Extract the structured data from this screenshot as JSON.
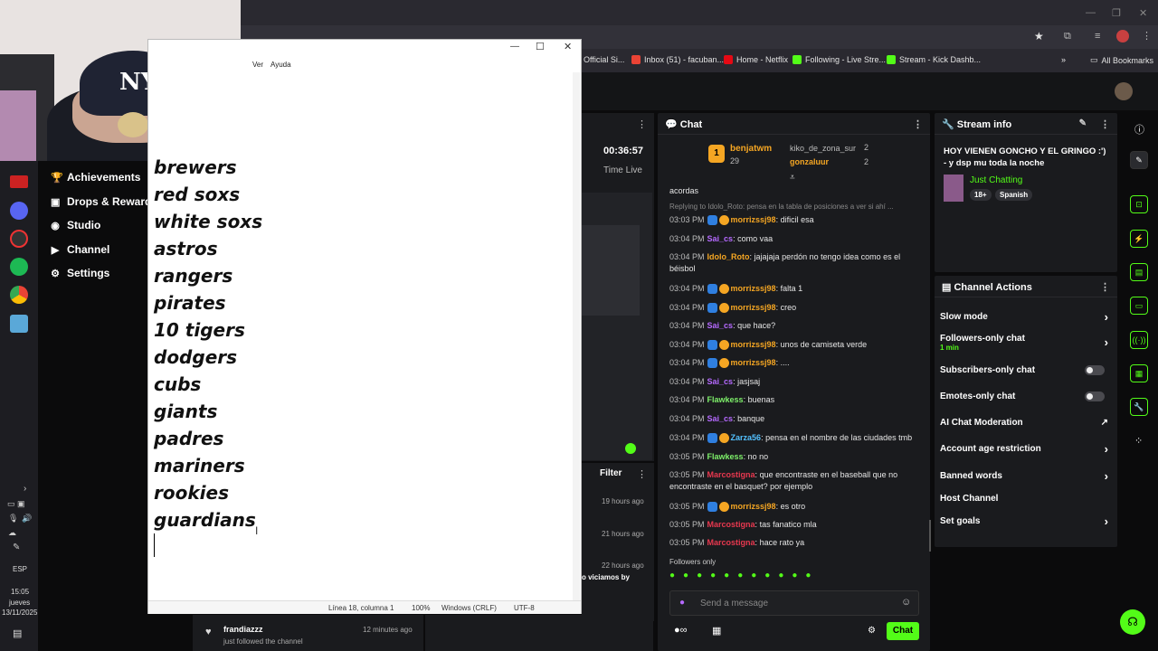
{
  "browser": {
    "bookmarks": [
      "Official Si...",
      "Inbox (51) - facuban...",
      "Home - Netflix",
      "Following - Live Stre...",
      "Stream - Kick Dashb..."
    ],
    "all_bookmarks": "All Bookmarks"
  },
  "left_nav": {
    "items": [
      {
        "label": "Achievements",
        "icon": "trophy-icon"
      },
      {
        "label": "Drops & Rewards",
        "icon": "gift-icon"
      },
      {
        "label": "Studio",
        "icon": "studio-icon"
      },
      {
        "label": "Channel",
        "icon": "channel-icon"
      },
      {
        "label": "Settings",
        "icon": "gear-icon"
      }
    ]
  },
  "taskbar": {
    "lang": "ESP",
    "time": "15:05",
    "day": "jueves",
    "date": "13/11/2025"
  },
  "notepad": {
    "menu_ver": "Ver",
    "menu_ayuda": "Ayuda",
    "lines": [
      "brewers",
      "red soxs",
      "white soxs",
      "astros",
      "rangers",
      "pirates",
      "10 tigers",
      "dodgers",
      "cubs",
      "giants",
      "padres",
      "mariners",
      "rookies",
      "guardians"
    ],
    "status": {
      "position": "Línea 18, columna 1",
      "zoom": "100%",
      "eol": "Windows (CRLF)",
      "encoding": "UTF-8"
    }
  },
  "mid": {
    "timer": "00:36:57",
    "timer_label": "Time Live",
    "filter": "Filter",
    "times": [
      "19 hours ago",
      "21 hours ago",
      "22 hours ago"
    ],
    "snippet": "o viciamos by"
  },
  "activity": {
    "user": "frandiazzz",
    "time": "12 minutes ago",
    "text": "just followed the channel"
  },
  "chat": {
    "title": "Chat",
    "top": {
      "user1": "benjatwm",
      "count1": "29",
      "user2": "kiko_de_zona_sur",
      "count2": "2",
      "user3": "gonzaluur",
      "count3": "2"
    },
    "pinned_text": "acordas",
    "reply_text": "Replying to Idolo_Roto: pensa en la tabla de posiciones a ver si ahí ...",
    "messages": [
      {
        "time": "03:03 PM",
        "user": "morrizssj98",
        "text": "dificil esa",
        "color": "#f5a623",
        "badges": true
      },
      {
        "time": "03:04 PM",
        "user": "Sai_cs",
        "text": "como vaa",
        "color": "#b569ff",
        "badges": false
      },
      {
        "time": "03:04 PM",
        "user": "Idolo_Roto",
        "text": "jajajaja perdón no tengo idea como es el béisbol",
        "color": "#f5a623",
        "badges": false
      },
      {
        "time": "03:04 PM",
        "user": "morrizssj98",
        "text": "falta 1",
        "color": "#f5a623",
        "badges": true
      },
      {
        "time": "03:04 PM",
        "user": "morrizssj98",
        "text": "creo",
        "color": "#f5a623",
        "badges": true
      },
      {
        "time": "03:04 PM",
        "user": "Sai_cs",
        "text": "que hace?",
        "color": "#b569ff",
        "badges": false
      },
      {
        "time": "03:04 PM",
        "user": "morrizssj98",
        "text": "unos de camiseta verde",
        "color": "#f5a623",
        "badges": true
      },
      {
        "time": "03:04 PM",
        "user": "morrizssj98",
        "text": "....",
        "color": "#f5a623",
        "badges": true
      },
      {
        "time": "03:04 PM",
        "user": "Sai_cs",
        "text": "jasjsaj",
        "color": "#b569ff",
        "badges": false
      },
      {
        "time": "03:04 PM",
        "user": "Flawkess",
        "text": "buenas",
        "color": "#7ef06a",
        "badges": false
      },
      {
        "time": "03:04 PM",
        "user": "Sai_cs",
        "text": "banque",
        "color": "#b569ff",
        "badges": false
      },
      {
        "time": "03:04 PM",
        "user": "Zarza56",
        "text": "pensa en el nombre de las ciudades tmb",
        "color": "#53c1ff",
        "badges": true
      },
      {
        "time": "03:05 PM",
        "user": "Flawkess",
        "text": "no no",
        "color": "#7ef06a",
        "badges": false
      },
      {
        "time": "03:05 PM",
        "user": "Marcostigna",
        "text": "que encontraste en el baseball que no encontraste en el basquet? por ejemplo",
        "color": "#e8384f",
        "badges": false
      },
      {
        "time": "03:05 PM",
        "user": "morrizssj98",
        "text": "es otro",
        "color": "#f5a623",
        "badges": true
      },
      {
        "time": "03:05 PM",
        "user": "Marcostigna",
        "text": "tas fanatico mla",
        "color": "#e8384f",
        "badges": false
      },
      {
        "time": "03:05 PM",
        "user": "Marcostigna",
        "text": "hace rato ya",
        "color": "#e8384f",
        "badges": false
      }
    ],
    "followers_only": "Followers only",
    "input_placeholder": "Send a message",
    "chat_button": "Chat"
  },
  "stream_info": {
    "title": "Stream info",
    "stream_title": "HOY VIENEN GONCHO Y EL GRINGO :') - y dsp mu toda la noche",
    "category": "Just Chatting",
    "tags": [
      "18+",
      "Spanish"
    ]
  },
  "channel_actions": {
    "title": "Channel Actions",
    "items": [
      {
        "label": "Slow mode",
        "control": "arrow"
      },
      {
        "label": "Followers-only chat",
        "sub": "1 min",
        "control": "arrow"
      },
      {
        "label": "Subscribers-only chat",
        "control": "toggle"
      },
      {
        "label": "Emotes-only chat",
        "control": "toggle"
      },
      {
        "label": "AI Chat Moderation",
        "control": "external"
      },
      {
        "label": "Account age restriction",
        "control": "arrow"
      },
      {
        "label": "Banned words",
        "control": "arrow"
      },
      {
        "label": "Host Channel",
        "control": "none"
      },
      {
        "label": "Set goals",
        "control": "arrow"
      }
    ]
  },
  "colors": {
    "kick_green": "#53fc18",
    "panel": "#1a1b1e",
    "bg": "#0b0b0c"
  }
}
